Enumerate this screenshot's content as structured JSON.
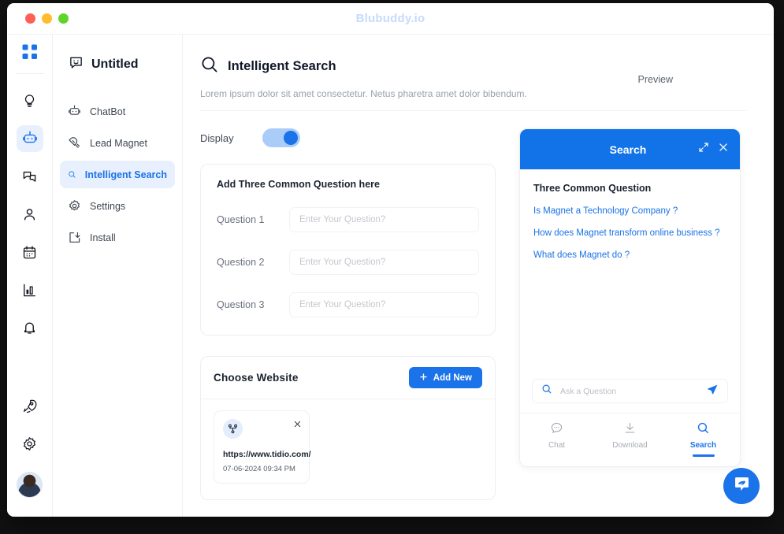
{
  "window": {
    "title": "Blubuddy.io",
    "traffic_lights": [
      "close-red",
      "minimize-amber",
      "maximize-green"
    ]
  },
  "rail": {
    "logo_icon": "grid-logo-icon",
    "items": [
      {
        "icon": "lightbulb-icon",
        "name": "ideas",
        "active": false
      },
      {
        "icon": "robot-icon",
        "name": "chatbot",
        "active": true
      },
      {
        "icon": "chat-bubbles-icon",
        "name": "conversations",
        "active": false
      },
      {
        "icon": "person-icon",
        "name": "contacts",
        "active": false
      },
      {
        "icon": "calendar-icon",
        "name": "calendar",
        "active": false
      },
      {
        "icon": "bar-chart-icon",
        "name": "analytics",
        "active": false
      },
      {
        "icon": "bell-icon",
        "name": "notifications",
        "active": false
      }
    ],
    "bottom_items": [
      {
        "icon": "rocket-icon",
        "name": "upgrade"
      },
      {
        "icon": "gear-icon",
        "name": "settings"
      }
    ],
    "avatar": "user-avatar"
  },
  "sidebar": {
    "header": {
      "icon": "smiley-chat-icon",
      "label": "Untitled"
    },
    "items": [
      {
        "label": "ChatBot",
        "icon": "robot-icon",
        "active": false
      },
      {
        "label": "Lead Magnet",
        "icon": "magnet-icon",
        "active": false
      },
      {
        "label": "Intelligent Search",
        "icon": "search-icon",
        "active": true
      },
      {
        "label": "Settings",
        "icon": "gear-icon",
        "active": false
      },
      {
        "label": "Install",
        "icon": "install-icon",
        "active": false
      }
    ]
  },
  "main": {
    "icon": "search-icon",
    "title": "Intelligent Search",
    "subtitle": "Lorem ipsum dolor sit amet consectetur. Netus pharetra amet dolor bibendum.",
    "preview_label": "Preview",
    "display": {
      "label": "Display",
      "enabled": true
    },
    "questions_card": {
      "title": "Add Three Common Question here",
      "rows": [
        {
          "label": "Question  1",
          "value": "",
          "placeholder": "Enter Your Question?"
        },
        {
          "label": "Question  2",
          "value": "",
          "placeholder": "Enter Your Question?"
        },
        {
          "label": "Question  3",
          "value": "",
          "placeholder": "Enter Your Question?"
        }
      ]
    },
    "website_card": {
      "title": "Choose  Website",
      "add_button": "Add New",
      "add_icon": "plus-icon",
      "entries": [
        {
          "icon": "sitemap-icon",
          "url": "https://www.tidio.com/",
          "date": "07-06-2024 09:34 PM",
          "close_icon": "close-icon"
        }
      ]
    }
  },
  "preview": {
    "header": {
      "title": "Search",
      "expand_icon": "expand-icon",
      "close_icon": "close-icon"
    },
    "questions_title": "Three Common Question",
    "questions": [
      "Is Magnet a Technology Company ?",
      "How does Magnet transform online business ?",
      "What does Magnet do ?"
    ],
    "search": {
      "icon": "search-icon",
      "placeholder": "Ask a Question",
      "send_icon": "send-icon",
      "value": ""
    },
    "tabs": [
      {
        "label": "Chat",
        "icon": "chat-bubble-icon",
        "active": false
      },
      {
        "label": "Download",
        "icon": "download-icon",
        "active": false
      },
      {
        "label": "Search",
        "icon": "search-icon",
        "active": true
      }
    ],
    "fab_icon": "chat-launcher-icon"
  },
  "colors": {
    "accent": "#1a73e8",
    "accent_header": "#1273e8",
    "accent_soft": "#e8f0fe",
    "title": "#c5dbfb",
    "text": "#101828",
    "muted": "#9aa1ab"
  }
}
